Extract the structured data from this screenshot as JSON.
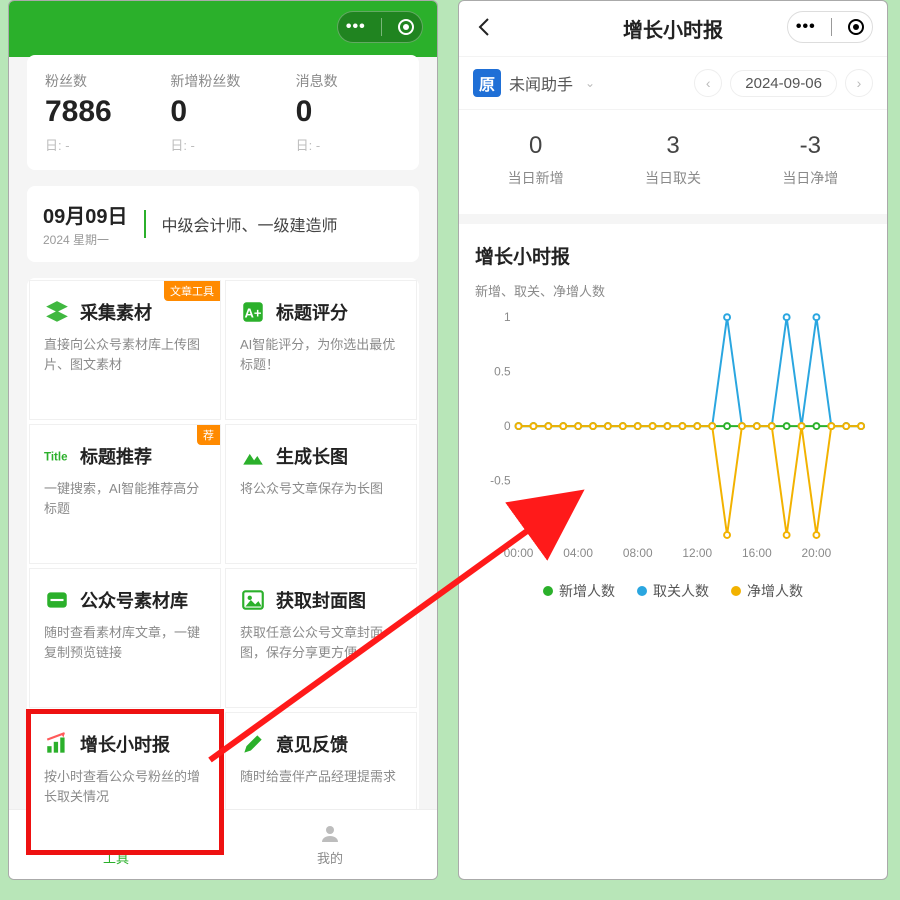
{
  "left": {
    "stats": [
      {
        "label": "粉丝数",
        "value": "7886",
        "sub": "日: -"
      },
      {
        "label": "新增粉丝数",
        "value": "0",
        "sub": "日: -"
      },
      {
        "label": "消息数",
        "value": "0",
        "sub": "日: -"
      }
    ],
    "date": {
      "main": "09月09日",
      "sub": "2024  星期一",
      "right": "中级会计师、一级建造师"
    },
    "badges": {
      "article": "文章工具",
      "rec": "荐"
    },
    "tools": [
      {
        "title": "采集素材",
        "desc": "直接向公众号素材库上传图片、图文素材"
      },
      {
        "title": "标题评分",
        "desc": "AI智能评分，为你选出最优标题！"
      },
      {
        "title": "标题推荐",
        "desc": "一键搜索，AI智能推荐高分标题"
      },
      {
        "title": "生成长图",
        "desc": "将公众号文章保存为长图"
      },
      {
        "title": "公众号素材库",
        "desc": "随时查看素材库文章，一键复制预览链接"
      },
      {
        "title": "获取封面图",
        "desc": "获取任意公众号文章封面图，保存分享更方便"
      },
      {
        "title": "增长小时报",
        "desc": "按小时查看公众号粉丝的增长取关情况"
      },
      {
        "title": "意见反馈",
        "desc": "随时给壹伴产品经理提需求"
      }
    ],
    "nav": {
      "tools": "工具",
      "mine": "我的"
    }
  },
  "right": {
    "title": "增长小时报",
    "account": "未闻助手",
    "date": "2024-09-06",
    "stats": [
      {
        "val": "0",
        "lab": "当日新增"
      },
      {
        "val": "3",
        "lab": "当日取关"
      },
      {
        "val": "-3",
        "lab": "当日净增"
      }
    ],
    "chart_title": "增长小时报",
    "chart_sub": "新增、取关、净增人数",
    "legend": [
      {
        "name": "新增人数",
        "color": "#2bb02b"
      },
      {
        "name": "取关人数",
        "color": "#2aa6e0"
      },
      {
        "name": "净增人数",
        "color": "#f2b200"
      }
    ]
  },
  "chart_data": {
    "type": "line",
    "xlabel": "",
    "ylabel": "",
    "ylim": [
      -1,
      1
    ],
    "x_ticks": [
      "00:00",
      "04:00",
      "08:00",
      "12:00",
      "16:00",
      "20:00"
    ],
    "y_ticks": [
      -0.5,
      0,
      0.5,
      1
    ],
    "x_hours": [
      0,
      1,
      2,
      3,
      4,
      5,
      6,
      7,
      8,
      9,
      10,
      11,
      12,
      13,
      14,
      15,
      16,
      17,
      18,
      19,
      20,
      21,
      22,
      23
    ],
    "series": [
      {
        "name": "新增人数",
        "color": "#2bb02b",
        "values": [
          0,
          0,
          0,
          0,
          0,
          0,
          0,
          0,
          0,
          0,
          0,
          0,
          0,
          0,
          0,
          0,
          0,
          0,
          0,
          0,
          0,
          0,
          0,
          0
        ]
      },
      {
        "name": "取关人数",
        "color": "#2aa6e0",
        "values": [
          0,
          0,
          0,
          0,
          0,
          0,
          0,
          0,
          0,
          0,
          0,
          0,
          0,
          0,
          1,
          0,
          0,
          0,
          1,
          0,
          1,
          0,
          0,
          0
        ]
      },
      {
        "name": "净增人数",
        "color": "#f2b200",
        "values": [
          0,
          0,
          0,
          0,
          0,
          0,
          0,
          0,
          0,
          0,
          0,
          0,
          0,
          0,
          -1,
          0,
          0,
          0,
          -1,
          0,
          -1,
          0,
          0,
          0
        ]
      }
    ]
  }
}
